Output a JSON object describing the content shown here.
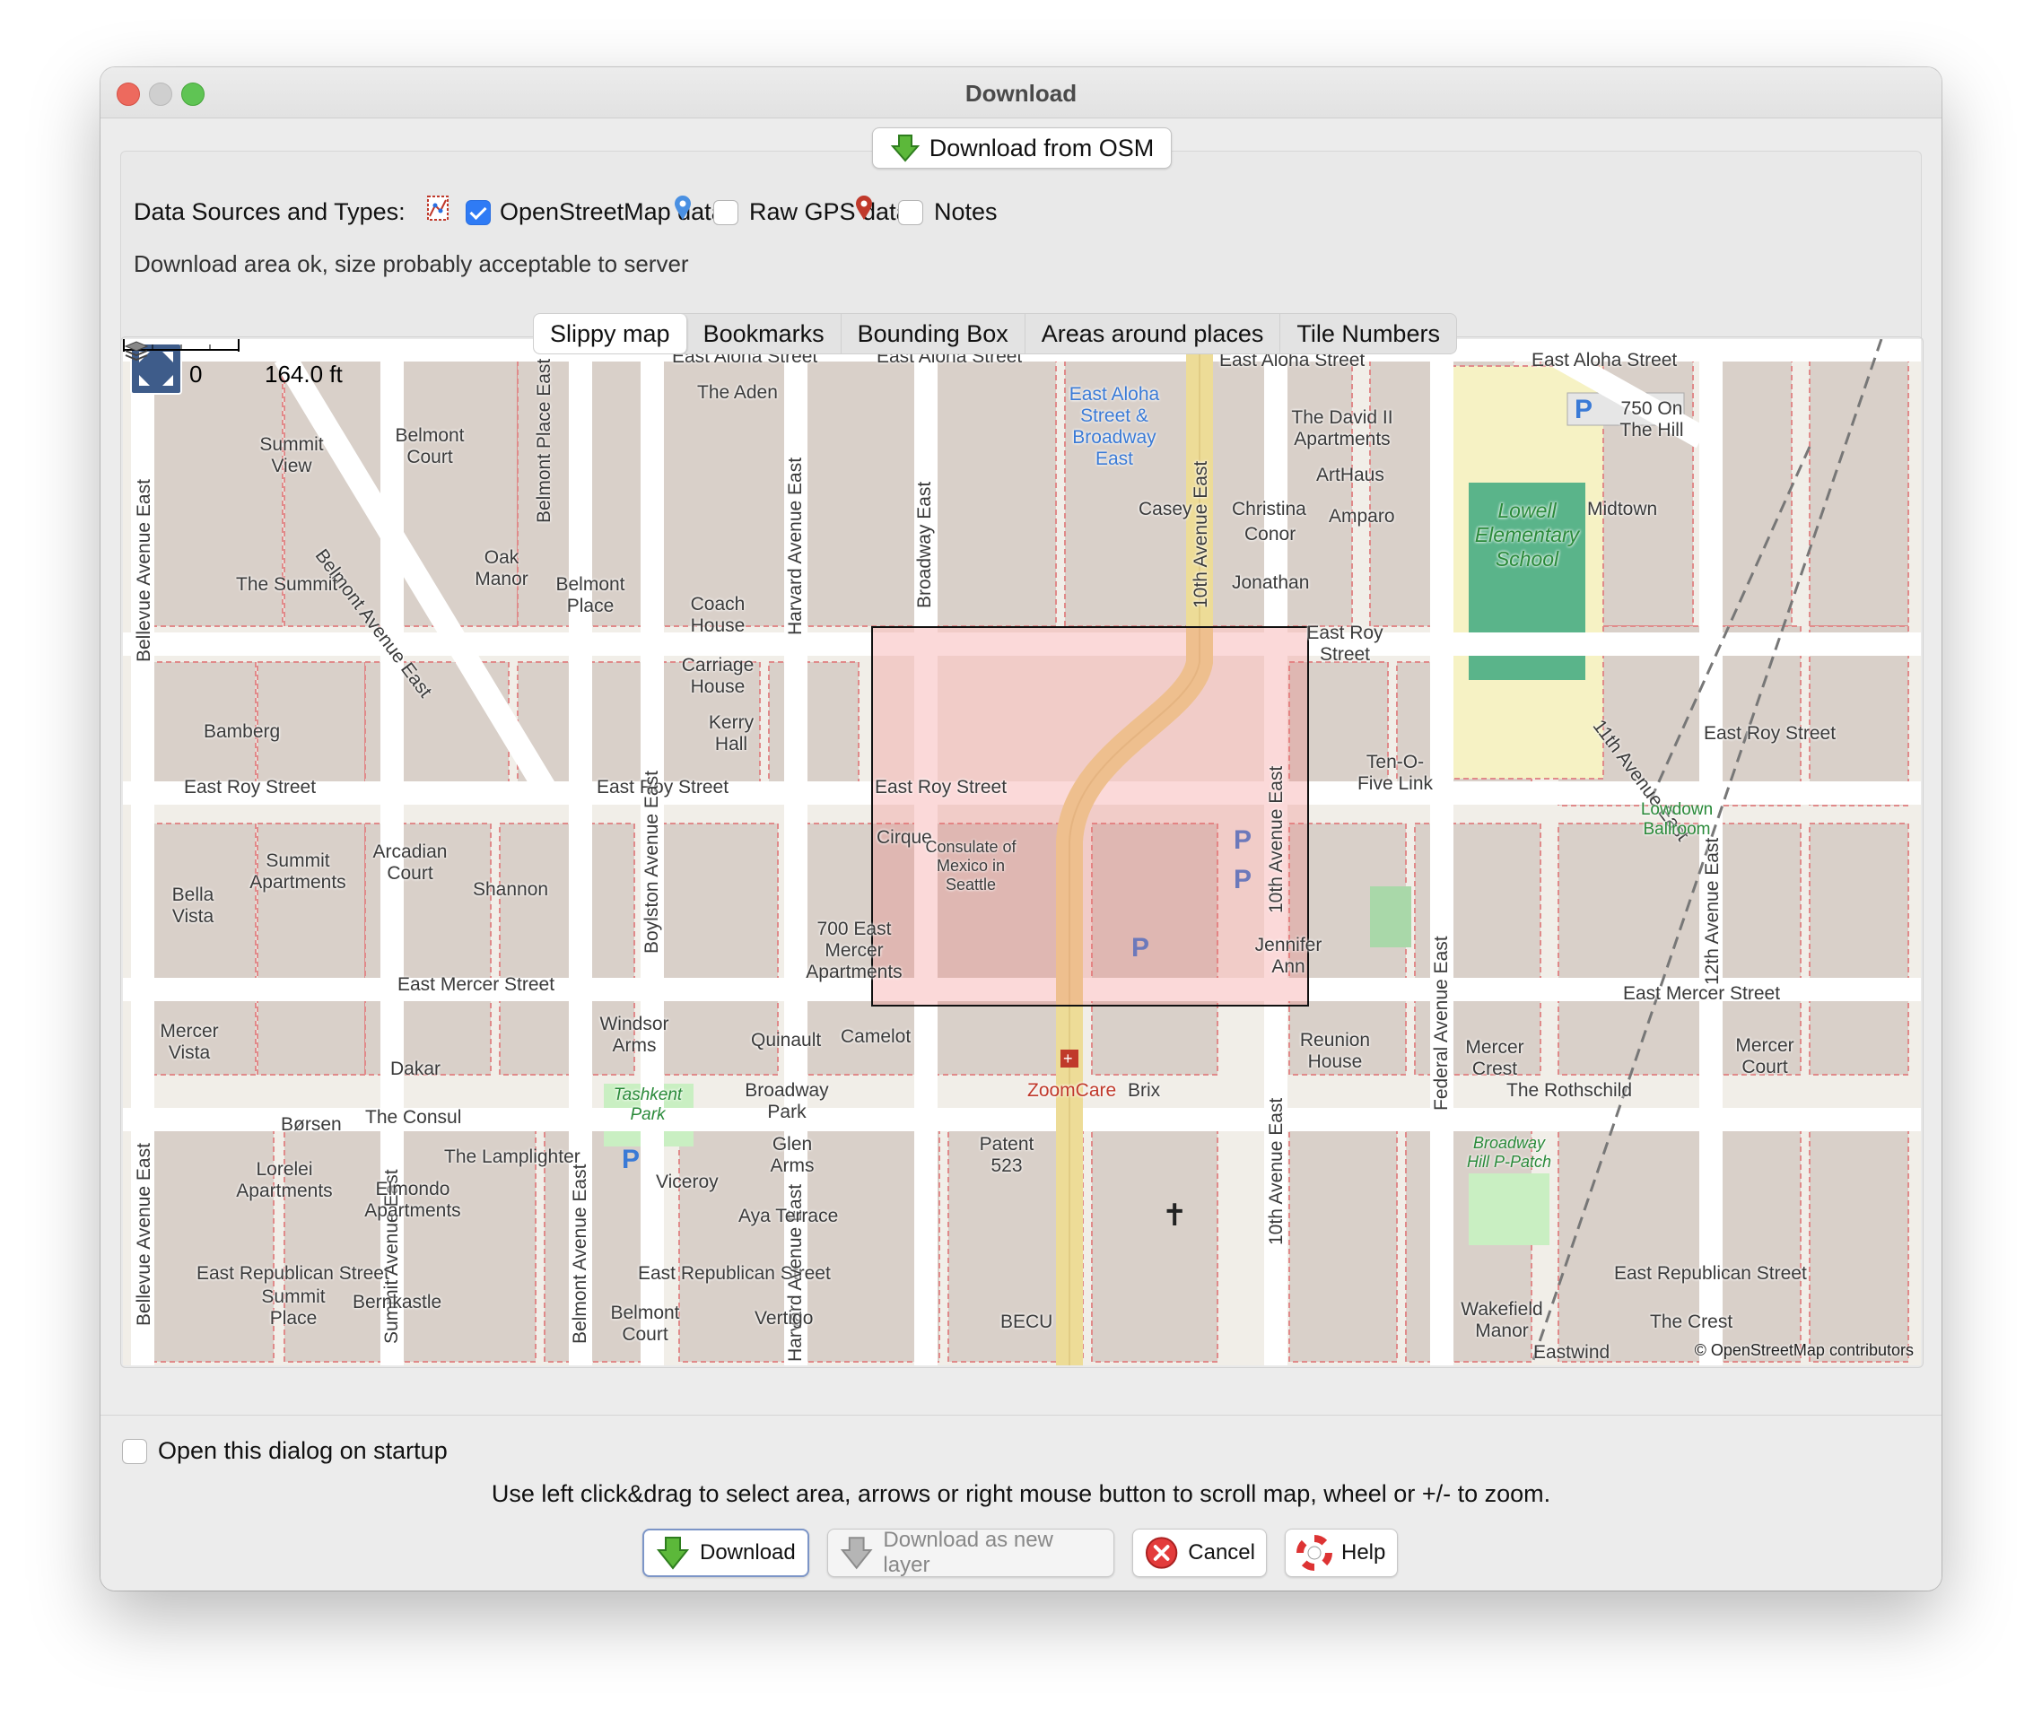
{
  "window": {
    "title": "Download"
  },
  "osm_button": {
    "label": "Download from OSM"
  },
  "sources": {
    "label": "Data Sources and Types:",
    "options": [
      {
        "label": "OpenStreetMap data",
        "checked": true,
        "icon": "osm-data-icon"
      },
      {
        "label": "Raw GPS data",
        "checked": false,
        "icon": "gps-pin-icon"
      },
      {
        "label": "Notes",
        "checked": false,
        "icon": "notes-pin-icon"
      }
    ],
    "status": "Download area ok, size probably acceptable to server"
  },
  "tabs": [
    "Slippy map",
    "Bookmarks",
    "Bounding Box",
    "Areas around places",
    "Tile Numbers"
  ],
  "active_tab": "Slippy map",
  "map": {
    "scale_zero": "0",
    "scale_length": "164.0 ft",
    "copyright": "© OpenStreetMap contributors",
    "streets": {
      "aloha1": "East Aloha Street",
      "aloha2": "East Aloha Street",
      "aloha3": "East Aloha Street",
      "aloha4": "East Aloha Street",
      "roy1": "East Roy Street",
      "roy2": "East Roy Street",
      "roy3": "East Roy Street",
      "roy4": "East Roy Street",
      "mercer1": "East Mercer Street",
      "mercer2": "East Mercer Street",
      "republican1": "East Republican Street",
      "republican2": "East Republican Street",
      "republican3": "East Republican Street",
      "bellevue": "Bellevue Avenue East",
      "bellevue2": "Bellevue Avenue East",
      "belmont_diag": "Belmont Avenue East",
      "belmont": "Belmont Avenue East",
      "belmont_place": "Belmont Place East",
      "summit": "Summit Avenue East",
      "boylston": "Boylston Avenue East",
      "harvard": "Harvard Avenue East",
      "harvard2": "Harvard Avenue East",
      "broadway": "Broadway East",
      "tenth": "10th Avenue East",
      "tenth2": "10th Avenue East",
      "tenth3": "10th Avenue East",
      "eleventh": "11th Avenue East",
      "federal": "Federal Avenue East",
      "twelfth": "12th Avenue East"
    },
    "places": {
      "aden": "The Aden",
      "belmont_court": "Belmont Court",
      "summit_view": "Summit View",
      "the_summit": "The Summit",
      "oak_manor": "Oak Manor",
      "belmont_place": "Belmont Place",
      "coach_house": "Coach House",
      "carriage_house": "Carriage House",
      "kerry_hall": "Kerry Hall",
      "aloha_broadway": "East Aloha Street & Broadway East",
      "casey": "Casey",
      "david": "The David II Apartments",
      "arthaus": "ArtHaus",
      "christina": "Christina",
      "amparo": "Amparo",
      "conor": "Conor",
      "jonathan": "Jonathan",
      "east_roy_street": "East Roy Street",
      "lowell": "Lowell Elementary School",
      "midtown": "Midtown",
      "on_the_hill": "750 On The Hill",
      "bamberg": "Bamberg",
      "bella_vista": "Bella Vista",
      "summit_apts": "Summit Apartments",
      "arcadian": "Arcadian Court",
      "shannon": "Shannon",
      "cirque": "Cirque",
      "consulate": "Consulate of Mexico in Seattle",
      "mercer_apts": "700 East Mercer Apartments",
      "ten_o_five": "Ten-O-Five Link",
      "jennifer": "Jennifer Ann",
      "lowdown": "Lowdown Ballroom",
      "mercer_vista": "Mercer Vista",
      "dakar": "Dakar",
      "windsor": "Windsor Arms",
      "quinault": "Quinault",
      "camelot": "Camelot",
      "tashkent": "Tashkent Park",
      "broadway_park": "Broadway Park",
      "zoomcare": "ZoomCare",
      "brix": "Brix",
      "reunion": "Reunion House",
      "mercer_crest": "Mercer Crest",
      "mercer_court": "Mercer Court",
      "rothschild": "The Rothschild",
      "borsen": "Børsen",
      "consul": "The Consul",
      "lamplighter": "The Lamplighter",
      "lorelei": "Lorelei Apartments",
      "elmondo": "Elmondo Apartments",
      "glen_arms": "Glen Arms",
      "patent": "Patent 523",
      "viceroy": "Viceroy",
      "aya": "Aya Terrace",
      "hill_p_patch": "Broadway Hill P-Patch",
      "summit_place": "Summit Place",
      "bernkastle": "Bernkastle",
      "belmont_court2": "Belmont Court",
      "vertigo": "Vertigo",
      "becu": "BECU",
      "wakefield": "Wakefield Manor",
      "crest": "The Crest",
      "eastwind": "Eastwind"
    }
  },
  "startup": {
    "label": "Open this dialog on startup",
    "checked": false
  },
  "hint": "Use left click&drag to select area, arrows or right mouse button to scroll map, wheel or +/- to zoom.",
  "buttons": {
    "download": "Download",
    "download_new_layer": "Download as new layer",
    "cancel": "Cancel",
    "help": "Help"
  }
}
